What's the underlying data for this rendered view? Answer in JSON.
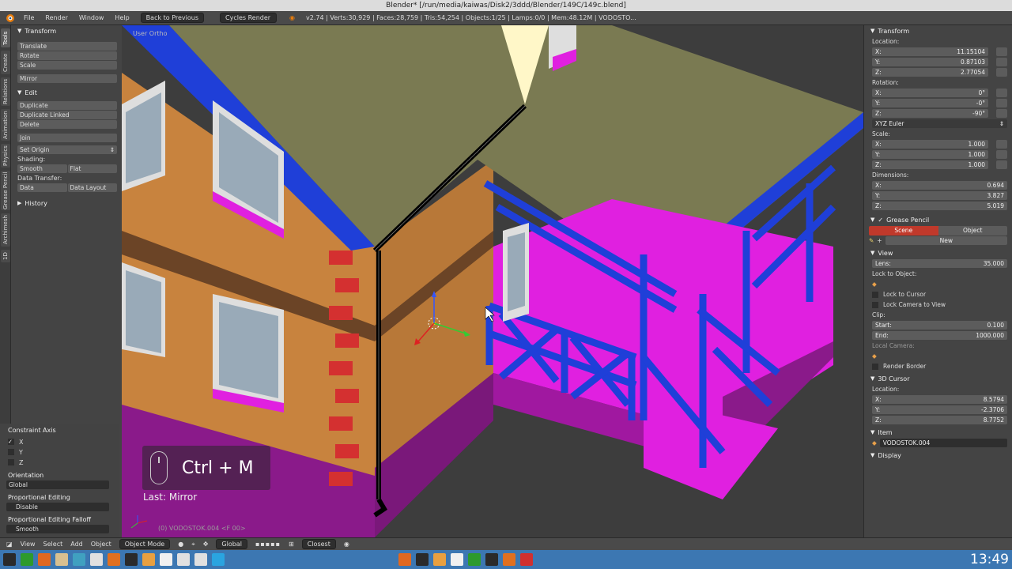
{
  "window": {
    "title": "Blender* [/run/media/kaiwas/Disk2/3ddd/Blender/149C/149c.blend]"
  },
  "menubar": {
    "menus": [
      "File",
      "Render",
      "Window",
      "Help"
    ],
    "back_button": "Back to Previous",
    "engine": "Cycles Render",
    "stats": "v2.74 | Verts:30,929 | Faces:28,759 | Tris:54,254 | Objects:1/25 | Lamps:0/0 | Mem:48.12M | VODOSTO..."
  },
  "vtabs": [
    "Tools",
    "Create",
    "Relations",
    "Animation",
    "Physics",
    "Grease Pencil",
    "Archimesh",
    "1D"
  ],
  "toolshelf": {
    "transform_header": "Transform",
    "transform": [
      "Translate",
      "Rotate",
      "Scale"
    ],
    "mirror": "Mirror",
    "edit_header": "Edit",
    "edit": [
      "Duplicate",
      "Duplicate Linked",
      "Delete"
    ],
    "join": "Join",
    "set_origin": "Set Origin",
    "shading_label": "Shading:",
    "smooth": "Smooth",
    "flat": "Flat",
    "data_transfer_label": "Data Transfer:",
    "data": "Data",
    "data_layout": "Data Layout",
    "history_header": "History"
  },
  "operator_panel": {
    "constraint_axis_label": "Constraint Axis",
    "axes": [
      "X",
      "Y",
      "Z"
    ],
    "orientation_label": "Orientation",
    "orientation_value": "Global",
    "proportional_label": "Proportional Editing",
    "proportional_value": "Disable",
    "falloff_label": "Proportional Editing Falloff",
    "falloff_value": "Smooth"
  },
  "viewport": {
    "view_name": "User Ortho",
    "object_label": "(0) VODOSTOK.004 <F 00>",
    "shortcut": "Ctrl + M",
    "last_op": "Last: Mirror"
  },
  "properties": {
    "transform_header": "Transform",
    "location_label": "Location:",
    "location": [
      [
        "X:",
        "11.15104"
      ],
      [
        "Y:",
        "0.87103"
      ],
      [
        "Z:",
        "2.77054"
      ]
    ],
    "rotation_label": "Rotation:",
    "rotation": [
      [
        "X:",
        "0°"
      ],
      [
        "Y:",
        "-0°"
      ],
      [
        "Z:",
        "-90°"
      ]
    ],
    "rotation_mode": "XYZ Euler",
    "scale_label": "Scale:",
    "scale": [
      [
        "X:",
        "1.000"
      ],
      [
        "Y:",
        "1.000"
      ],
      [
        "Z:",
        "1.000"
      ]
    ],
    "dimensions_label": "Dimensions:",
    "dimensions": [
      [
        "X:",
        "0.694"
      ],
      [
        "Y:",
        "3.827"
      ],
      [
        "Z:",
        "5.019"
      ]
    ],
    "grease_header": "Grease Pencil",
    "scene_tab": "Scene",
    "object_tab": "Object",
    "new_button": "New",
    "view_header": "View",
    "lens_label": "Lens:",
    "lens_value": "35.000",
    "lock_to_object": "Lock to Object:",
    "lock_to_cursor": "Lock to Cursor",
    "lock_camera": "Lock Camera to View",
    "clip_label": "Clip:",
    "clip_start_label": "Start:",
    "clip_start": "0.100",
    "clip_end_label": "End:",
    "clip_end": "1000.000",
    "local_camera": "Local Camera:",
    "render_border": "Render Border",
    "cursor_header": "3D Cursor",
    "cursor_location_label": "Location:",
    "cursor": [
      [
        "X:",
        "8.5794"
      ],
      [
        "Y:",
        "-2.3706"
      ],
      [
        "Z:",
        "8.7752"
      ]
    ],
    "item_header": "Item",
    "item_name": "VODOSTOK.004",
    "display_header": "Display"
  },
  "bottombar": {
    "items": [
      "View",
      "Select",
      "Add",
      "Object"
    ],
    "mode": "Object Mode",
    "orientation": "Global",
    "snap": "Closest"
  },
  "taskbar": {
    "time": "13:49"
  },
  "colors": {
    "wall": "#c8833e",
    "roof": "#7a7a52",
    "blue": "#1f3fd8",
    "magenta": "#e020e0",
    "purple": "#8a1a8a"
  }
}
